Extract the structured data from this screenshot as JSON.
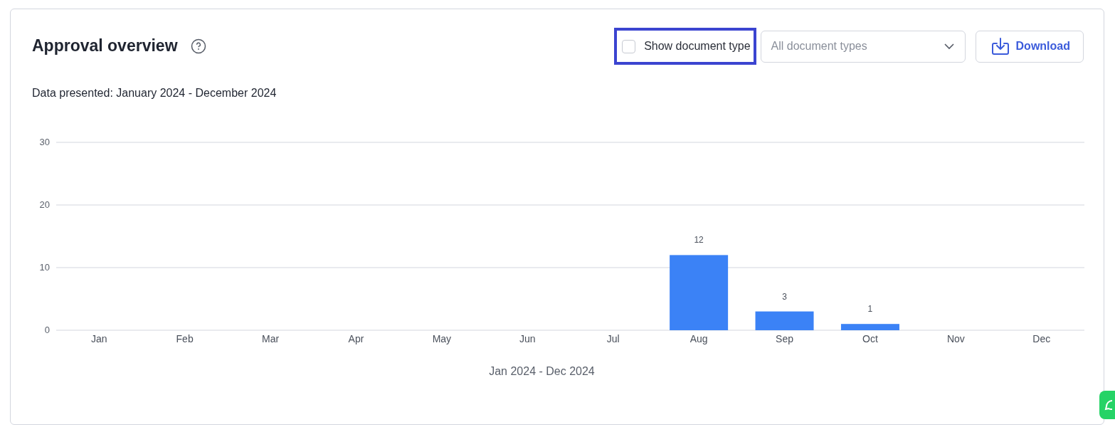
{
  "card": {
    "title": "Approval overview",
    "show_document_type": {
      "label": "Show document type",
      "checked": false,
      "highlighted": true
    },
    "document_type_select": {
      "placeholder": "All document types"
    },
    "download_button": {
      "label": "Download"
    },
    "subtitle": "Data presented: January 2024 - December 2024",
    "chart_data": {
      "type": "bar",
      "xlabel": "Jan 2024 - Dec 2024",
      "categories": [
        "Jan",
        "Feb",
        "Mar",
        "Apr",
        "May",
        "Jun",
        "Jul",
        "Aug",
        "Sep",
        "Oct",
        "Nov",
        "Dec"
      ],
      "series": [
        {
          "color": "#3b82f6",
          "values": [
            0,
            0,
            0,
            0,
            0,
            0,
            0,
            12,
            3,
            1,
            0,
            0
          ]
        }
      ],
      "ylim": [
        0,
        30
      ],
      "yticks": [
        0,
        10,
        20,
        30
      ],
      "value_labels": [
        null,
        null,
        null,
        null,
        null,
        null,
        null,
        "12",
        "3",
        "1",
        null,
        null
      ]
    }
  }
}
